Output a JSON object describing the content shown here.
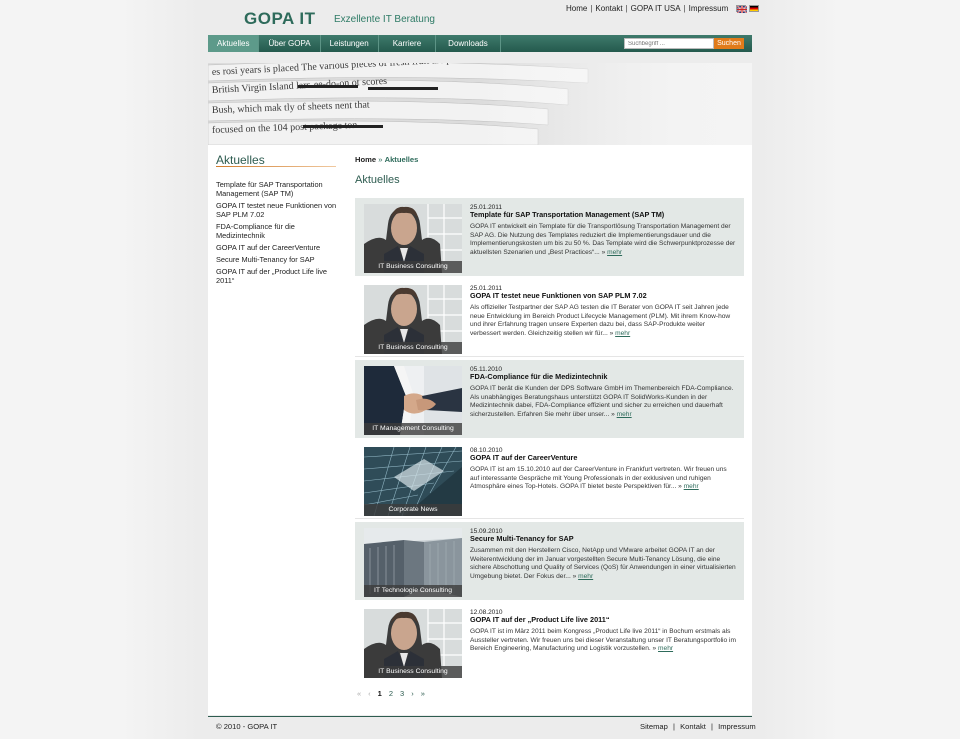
{
  "header": {
    "logo": "GOPA IT",
    "tagline": "Exzellente IT Beratung",
    "top_links": [
      "Home",
      "Kontakt",
      "GOPA IT USA",
      "Impressum"
    ]
  },
  "nav": {
    "items": [
      "Aktuelles",
      "Über GOPA",
      "Leistungen",
      "Karriere",
      "Downloads"
    ],
    "active": "Aktuelles",
    "search_placeholder": "Suchbegriff ...",
    "search_button": "Suchen"
  },
  "sidebar": {
    "title": "Aktuelles",
    "items": [
      "Template für SAP Transportation Management (SAP TM)",
      "GOPA IT testet neue Funktionen von SAP PLM 7.02",
      "FDA-Compliance für die Medizintechnik",
      "GOPA IT auf der CareerVenture",
      "Secure Multi-Tenancy for SAP",
      "GOPA IT auf der „Product Life live 2011“"
    ]
  },
  "breadcrumb": {
    "home": "Home",
    "separator": "»",
    "current": "Aktuelles"
  },
  "main": {
    "title": "Aktuelles",
    "more_label": "mehr",
    "articles": [
      {
        "date": "25.01.2011",
        "title": "Template für SAP Transportation Management (SAP TM)",
        "text": "GOPA IT entwickelt ein Template für die Transportlösung Transportation Management der SAP AG. Die Nutzung des Templates reduziert die Implementierungsdauer und die Implementierungskosten um bis zu 50 %. Das Template wird die Schwerpunktprozesse der aktuellsten Szenarien und „Best Practices“... »",
        "category": "IT Business Consulting",
        "image": "man-portrait"
      },
      {
        "date": "25.01.2011",
        "title": "GOPA IT testet neue Funktionen von SAP PLM 7.02",
        "text": "Als offizieller Testpartner der SAP AG testen die IT Berater von GOPA IT seit Jahren jede neue Entwicklung im Bereich Product Lifecycle Management (PLM). Mit ihrem Know-how und ihrer Erfahrung tragen unsere Experten dazu bei, dass SAP-Produkte weiter verbessert werden. Gleichzeitig stellen wir für... »",
        "category": "IT Business Consulting",
        "image": "man-portrait"
      },
      {
        "date": "05.11.2010",
        "title": "FDA-Compliance für die Medizintechnik",
        "text": "GOPA IT berät die Kunden der DPS Software GmbH im Themenbereich FDA-Compliance. Als unabhängiges Beratungshaus unterstützt GOPA IT SolidWorks-Kunden in der Medizintechnik dabei, FDA-Compliance effizient und sicher zu erreichen und dauerhaft sicherzustellen. Erfahren Sie mehr über unser... »",
        "category": "IT Management Consulting",
        "image": "handshake"
      },
      {
        "date": "08.10.2010",
        "title": "GOPA IT auf der CareerVenture",
        "text": "GOPA IT ist am 15.10.2010 auf der CareerVenture in Frankfurt vertreten. Wir freuen uns auf interessante Gespräche mit Young Professionals in der exklusiven und ruhigen Atmosphäre eines Top-Hotels. GOPA IT bietet beste Perspektiven für... »",
        "category": "Corporate News",
        "image": "skyscraper"
      },
      {
        "date": "15.09.2010",
        "title": "Secure Multi-Tenancy for SAP",
        "text": "Zusammen mit den Herstellern Cisco, NetApp und VMware arbeitet GOPA IT an der Weiterentwicklung der im Januar vorgestellten Secure Multi-Tenancy Lösung, die eine sichere Abschottung und Quality of Services (QoS) für Anwendungen in einer virtualisierten Umgebung bietet. Der Fokus der... »",
        "category": "IT Technologie Consulting",
        "image": "server-room"
      },
      {
        "date": "12.08.2010",
        "title": "GOPA IT auf der „Product Life live 2011“",
        "text": "GOPA IT ist im März 2011 beim Kongress „Product Life live 2011“ in Bochum erstmals als Aussteller vertreten. Wir freuen uns bei dieser Veranstaltung unser IT Beratungsportfolio im Bereich Engineering, Manufacturing und Logistik vorzustellen. »",
        "category": "IT Business Consulting",
        "image": "man-portrait"
      }
    ]
  },
  "pager": {
    "first": "«",
    "prev": "‹",
    "pages": [
      "1",
      "2",
      "3"
    ],
    "current": "1",
    "next": "›",
    "last": "»"
  },
  "footer": {
    "copyright": "© 2010 - GOPA IT",
    "links": [
      "Sitemap",
      "Kontakt",
      "Impressum"
    ]
  },
  "colors": {
    "brand_green": "#2e6b5b",
    "nav_green": "#245a4d",
    "search_orange": "#e07b1a",
    "row_shade": "#e3e8e6"
  }
}
